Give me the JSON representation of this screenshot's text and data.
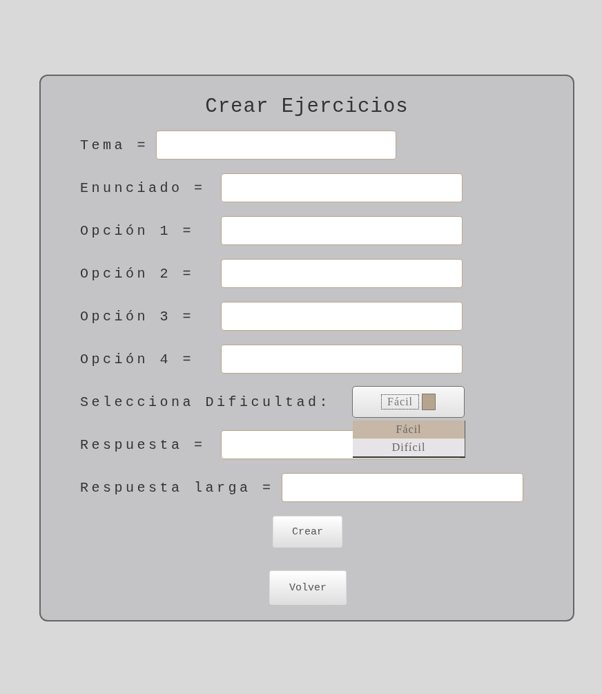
{
  "title": "Crear Ejercicios",
  "fields": [
    {
      "label": "Tema ="
    },
    {
      "label": "Enunciado ="
    },
    {
      "label": "Opción 1 ="
    },
    {
      "label": "Opción 2 ="
    },
    {
      "label": "Opción 3 ="
    },
    {
      "label": "Opción 4 ="
    }
  ],
  "difficulty": {
    "label": "Selecciona Dificultad:",
    "value": "Fácil",
    "expanded": true,
    "options": [
      {
        "label": "Fácil",
        "selected": true
      },
      {
        "label": "Difícil",
        "selected": false
      }
    ]
  },
  "answer": {
    "label": "Respuesta ="
  },
  "long_answer": {
    "label": "Respuesta larga ="
  },
  "buttons": [
    "Crear",
    "Volver"
  ]
}
